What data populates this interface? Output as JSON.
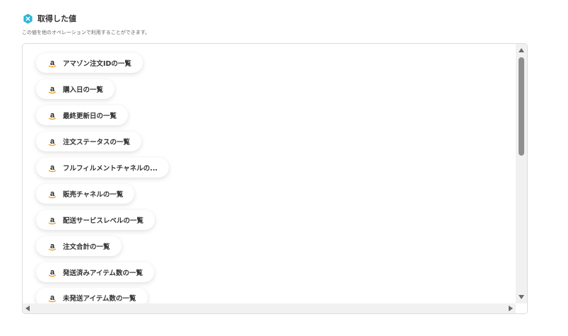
{
  "header": {
    "title": "取得した値",
    "icon": "hexagon-x-icon",
    "icon_color": "#2bb4d8"
  },
  "subtitle": "この値を他のオペレーションで利用することができます。",
  "items": [
    {
      "label": "アマゾン注文IDの一覧",
      "icon": "amazon-icon"
    },
    {
      "label": "購入日の一覧",
      "icon": "amazon-icon"
    },
    {
      "label": "最終更新日の一覧",
      "icon": "amazon-icon"
    },
    {
      "label": "注文ステータスの一覧",
      "icon": "amazon-icon"
    },
    {
      "label": "フルフィルメントチャネルの...",
      "icon": "amazon-icon"
    },
    {
      "label": "販売チャネルの一覧",
      "icon": "amazon-icon"
    },
    {
      "label": "配送サービスレベルの一覧",
      "icon": "amazon-icon"
    },
    {
      "label": "注文合計の一覧",
      "icon": "amazon-icon"
    },
    {
      "label": "発送済みアイテム数の一覧",
      "icon": "amazon-icon"
    },
    {
      "label": "未発送アイテム数の一覧",
      "icon": "amazon-icon"
    }
  ],
  "colors": {
    "amazon_arrow": "#f29b1d",
    "text": "#333333"
  }
}
